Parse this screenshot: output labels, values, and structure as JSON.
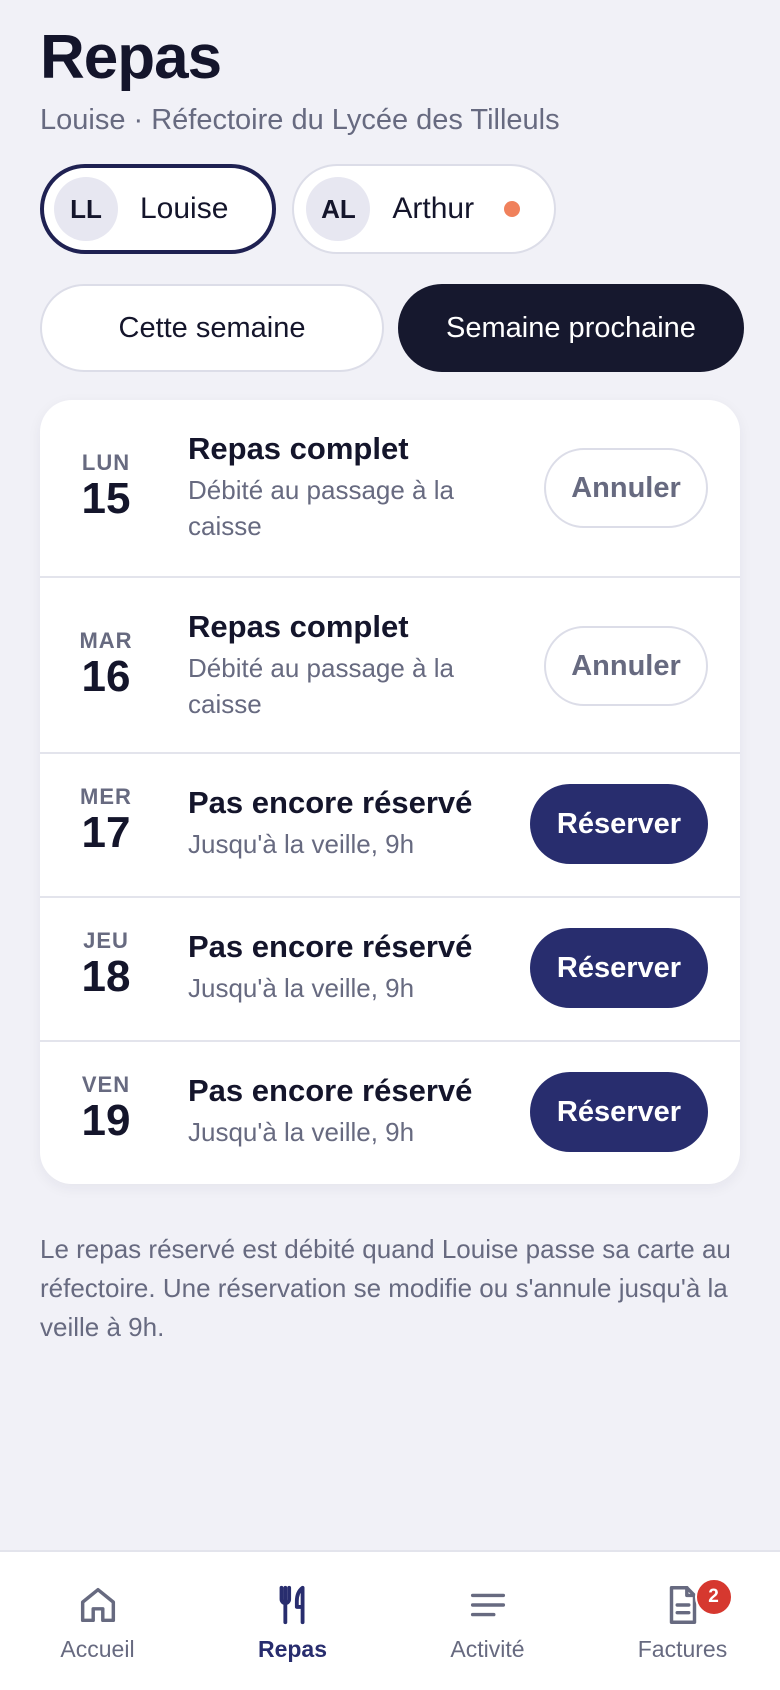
{
  "header": {
    "title": "Repas",
    "subtitle": "Louise · Réfectoire du Lycée des Tilleuls"
  },
  "children": [
    {
      "initials": "LL",
      "name": "Louise",
      "selected": true
    },
    {
      "initials": "AL",
      "name": "Arthur",
      "selected": false,
      "alert_color": "#f0815c"
    }
  ],
  "week_toggle": {
    "current": "Cette semaine",
    "next": "Semaine prochaine",
    "selected": "next"
  },
  "days": [
    {
      "dow": "LUN",
      "day": "15",
      "status": "Repas complet",
      "note": "Débité au passage à la caisse",
      "action": "Annuler"
    },
    {
      "dow": "MAR",
      "day": "16",
      "status": "Repas complet",
      "note": "Débité au passage à la caisse",
      "action": "Annuler"
    },
    {
      "dow": "MER",
      "day": "17",
      "status": "Pas encore réservé",
      "note": "Jusqu'à la veille, 9h",
      "action": "Réserver"
    },
    {
      "dow": "JEU",
      "day": "18",
      "status": "Pas encore réservé",
      "note": "Jusqu'à la veille, 9h",
      "action": "Réserver"
    },
    {
      "dow": "VEN",
      "day": "19",
      "status": "Pas encore réservé",
      "note": "Jusqu'à la veille, 9h",
      "action": "Réserver"
    }
  ],
  "footnote": "Le repas réservé est débité quand Louise passe sa carte au réfectoire. Une réservation se modifie ou s'annule jusqu'à la veille à 9h.",
  "tabbar": {
    "items": [
      {
        "label": "Accueil",
        "icon": "home-icon"
      },
      {
        "label": "Repas",
        "icon": "fork-knife-icon",
        "active": true
      },
      {
        "label": "Activité",
        "icon": "list-icon"
      },
      {
        "label": "Factures",
        "icon": "document-icon",
        "badge": "2"
      }
    ]
  },
  "colors": {
    "background": "#f1f1f7",
    "primary": "#282d6e",
    "dark": "#16182e",
    "muted": "#676a80",
    "alert_dot": "#f0815c",
    "badge": "#d6382f"
  }
}
